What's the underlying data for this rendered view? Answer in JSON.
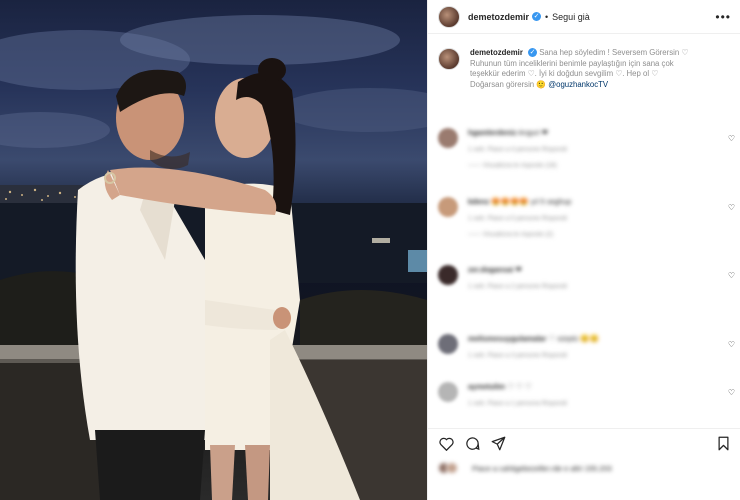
{
  "post": {
    "username": "demetozdemir",
    "follow_label": "Segui già",
    "more_label": "•••"
  },
  "caption": {
    "username": "demetozdemir",
    "line1": "Sana hep söyledim ! Seversem Görersin ♡",
    "line2": "Ruhunun tüm inceliklerini benimle paylaştığın için sana çok",
    "line3": "teşekkür ederim ♡. İyi ki doğdun sevgilim ♡. Hep ol ♡",
    "line4_prefix": "Doğarsan görersin 🙂 ",
    "mention": "@oguzhankocTV"
  },
  "comments": [
    {
      "user": "hgamlerdeniz",
      "text": "Anguri ❤",
      "meta": "1 sett.   Piace a 4 persone   Rispondi",
      "replies": "—— Visualizza le risposte (18)",
      "avatar_color": "#9a7b6f"
    },
    {
      "user": "kdenz",
      "text": "😍😍😍😍 yıl 5 seghup",
      "meta": "1 sett.   Piace a 5 persone   Rispondi",
      "replies": "—— Visualizza le risposte (2)",
      "avatar_color": "#c79a7a"
    },
    {
      "user": "zer.dogansai",
      "text": "❤",
      "meta": "1 sett.   Piace a 2 persone   Rispondi",
      "replies": "",
      "avatar_color": "#3a2a2a"
    },
    {
      "user": "melismesuygulamalar",
      "text": "♡ sürptü 😊😊",
      "meta": "1 sett.   Piace a 3 persone   Rispondi",
      "replies": "",
      "avatar_color": "#6e6e78"
    },
    {
      "user": "aymetulim",
      "text": "♡ ♡ ♡",
      "meta": "1 sett.   Piace a 1 persona   Rispondi",
      "replies": "",
      "avatar_color": "#b5b5b5"
    }
  ],
  "likes": {
    "text": "Piace a cahitgebezeller.rde e altri 155.203"
  },
  "icons": {
    "heart": "heart-icon",
    "comment": "comment-icon",
    "share": "share-icon",
    "bookmark": "bookmark-icon"
  }
}
